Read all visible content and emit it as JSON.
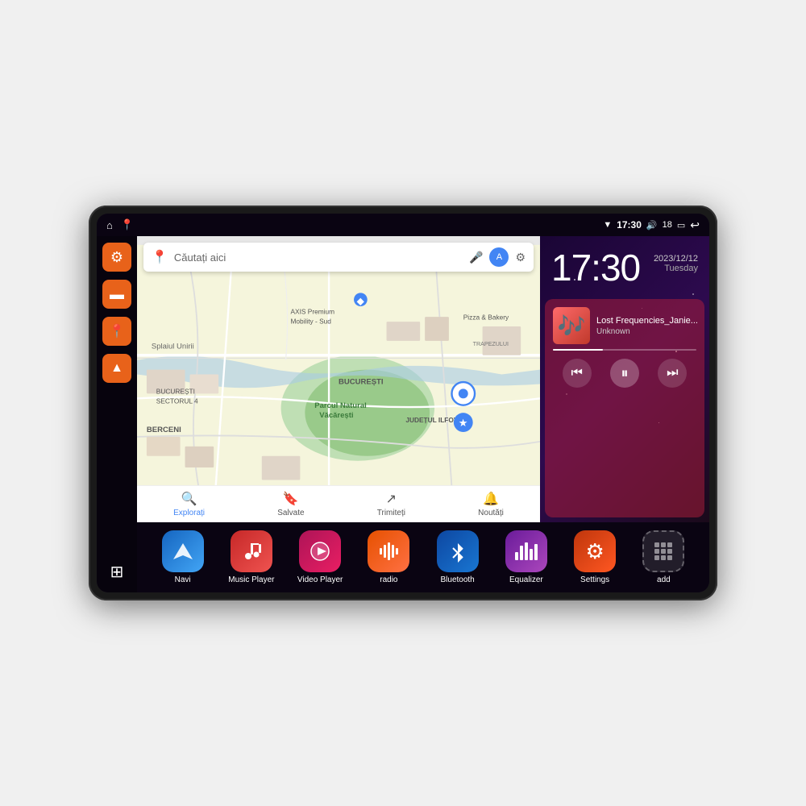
{
  "device": {
    "status_bar": {
      "wifi_icon": "▼",
      "time": "17:30",
      "volume_icon": "🔊",
      "battery_level": "18",
      "battery_icon": "🔋",
      "back_icon": "↩"
    },
    "sidebar": {
      "items": [
        {
          "id": "settings",
          "icon": "⚙",
          "color": "orange"
        },
        {
          "id": "files",
          "icon": "▬",
          "color": "orange"
        },
        {
          "id": "maps",
          "icon": "📍",
          "color": "orange"
        },
        {
          "id": "navigation",
          "icon": "▲",
          "color": "orange"
        }
      ],
      "bottom": {
        "id": "apps",
        "icon": "⊞"
      }
    },
    "map": {
      "search_placeholder": "Căutați aici",
      "bottom_items": [
        {
          "label": "Explorați",
          "icon": "🔍",
          "active": true
        },
        {
          "label": "Salvate",
          "icon": "🔖",
          "active": false
        },
        {
          "label": "Trimiteți",
          "icon": "↗",
          "active": false
        },
        {
          "label": "Noutăți",
          "icon": "🔔",
          "active": false
        }
      ],
      "places": [
        "AXIS Premium Mobility - Sud",
        "Parcul Natural Văcărești",
        "Pizza & Bakery",
        "BUCUREȘTI SECTORUL 4",
        "BERCENI",
        "BUCUREȘTI",
        "JUDEȚUL ILFOV",
        "TRAPEZULUI"
      ]
    },
    "clock": {
      "time": "17:30",
      "date": "2023/12/12",
      "day": "Tuesday"
    },
    "music": {
      "title": "Lost Frequencies_Janie...",
      "artist": "Unknown",
      "album_art_emoji": "🎵",
      "progress_percent": 35
    },
    "apps": [
      {
        "id": "navi",
        "label": "Navi",
        "color": "blue",
        "icon": "navi"
      },
      {
        "id": "music-player",
        "label": "Music Player",
        "color": "red",
        "icon": "music"
      },
      {
        "id": "video-player",
        "label": "Video Player",
        "color": "pink",
        "icon": "video"
      },
      {
        "id": "radio",
        "label": "radio",
        "color": "orange",
        "icon": "radio"
      },
      {
        "id": "bluetooth",
        "label": "Bluetooth",
        "color": "blue2",
        "icon": "bluetooth"
      },
      {
        "id": "equalizer",
        "label": "Equalizer",
        "color": "purple",
        "icon": "eq"
      },
      {
        "id": "settings",
        "label": "Settings",
        "color": "orange2",
        "icon": "gear"
      },
      {
        "id": "add",
        "label": "add",
        "color": "gray",
        "icon": "add"
      }
    ]
  }
}
